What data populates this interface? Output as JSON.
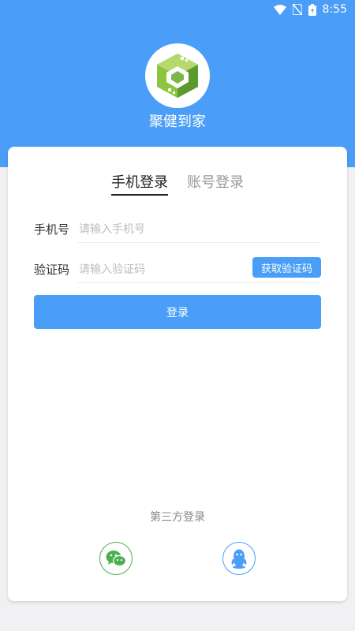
{
  "status_bar": {
    "time": "8:55"
  },
  "app": {
    "name": "聚健到家"
  },
  "tabs": [
    {
      "label": "手机登录",
      "active": true
    },
    {
      "label": "账号登录",
      "active": false
    }
  ],
  "form": {
    "phone": {
      "label": "手机号",
      "placeholder": "请输入手机号",
      "value": ""
    },
    "code": {
      "label": "验证码",
      "placeholder": "请输入验证码",
      "value": "",
      "get_code_label": "获取验证码"
    },
    "login_label": "登录"
  },
  "third_party": {
    "title": "第三方登录",
    "providers": [
      {
        "icon": "wechat-icon",
        "color": "#4caf50"
      },
      {
        "icon": "qq-icon",
        "color": "#4a9ef7"
      }
    ]
  },
  "colors": {
    "primary": "#4a9ef7",
    "wechat": "#4caf50",
    "background": "#f1f1f3"
  }
}
